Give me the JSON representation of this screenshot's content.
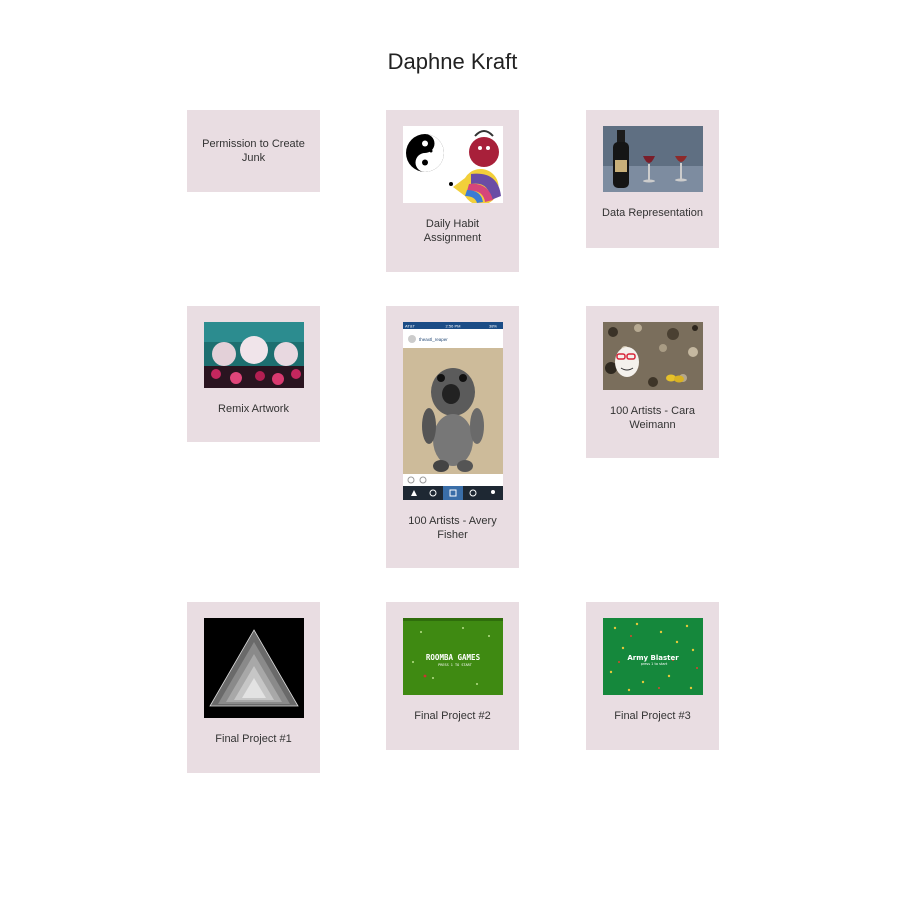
{
  "page": {
    "title": "Daphne Kraft"
  },
  "projects": [
    {
      "label": "Permission to Create Junk",
      "thumbnail": "none"
    },
    {
      "label": "Daily Habit Assignment",
      "thumbnail": "yin-yang-pacman-illustration"
    },
    {
      "label": "Data Representation",
      "thumbnail": "wine-bottle-glasses-photo"
    },
    {
      "label": "Remix Artwork",
      "thumbnail": "teal-collage-artwork"
    },
    {
      "label": "100 Artists - Avery Fisher",
      "thumbnail": "instagram-stuffed-animal-screenshot",
      "instagram": {
        "username": "theaxtl_reaper",
        "carrier": "AT&T",
        "time": "2:56 PM",
        "battery": "38%"
      }
    },
    {
      "label": "100 Artists - Cara Weimann",
      "thumbnail": "egg-with-glasses-on-granite-photo"
    },
    {
      "label": "Final Project #1",
      "thumbnail": "grayscale-triangle-render"
    },
    {
      "label": "Final Project #2",
      "thumbnail": "game-title-screen-green",
      "game": {
        "title": "ROOMBA GAMES",
        "subtitle": "PRESS 1 TO START"
      }
    },
    {
      "label": "Final Project #3",
      "thumbnail": "game-title-screen-green",
      "game": {
        "title": "Army Blaster",
        "subtitle": "press 1 to start"
      }
    }
  ],
  "colors": {
    "card_bg": "#e9dde2",
    "game_green": "#3f8a12",
    "game_green_dark": "#15883c"
  }
}
